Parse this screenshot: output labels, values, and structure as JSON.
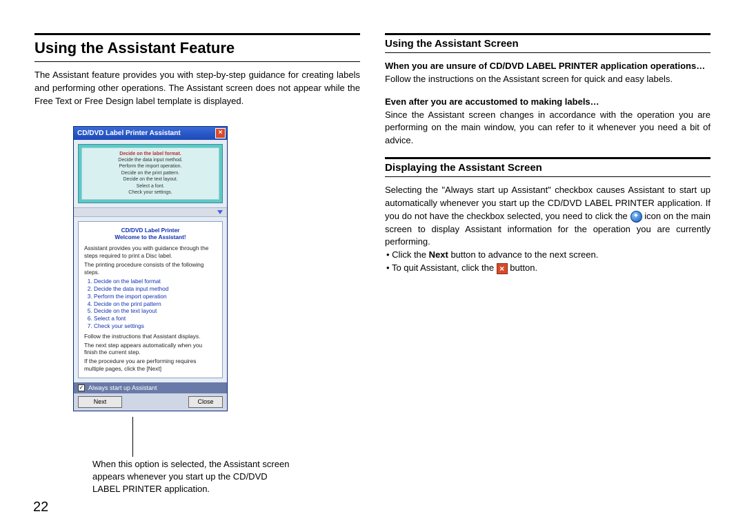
{
  "page_number": "22",
  "left": {
    "heading": "Using the Assistant Feature",
    "intro": "The Assistant feature provides you with step-by-step guidance for creating labels and performing other operations. The Assistant screen does not appear while the Free Text or Free Design label template is displayed.",
    "caption": "When this option is selected, the Assistant screen appears whenever you start up the CD/DVD LABEL PRINTER application."
  },
  "assistant_window": {
    "title": "CD/DVD Label Printer Assistant",
    "steps_current": "Decide on the label format.",
    "steps": [
      "Decide the data input method.",
      "Perform the import operation.",
      "Decide on the print pattern.",
      "Decide on the text layout.",
      "Select a font.",
      "Check your settings."
    ],
    "content_title1": "CD/DVD Label Printer",
    "content_title2": "Welcome to the Assistant!",
    "content_intro": "Assistant provides you with guidance through the steps required to print a Disc label.",
    "content_intro2": "The printing procedure consists of the following steps.",
    "ol": [
      "Decide on the label format",
      "Decide the data input method",
      "Perform the import operation",
      "Decide on the print pattern",
      "Decide on the text layout",
      "Select a font",
      "Check your settings"
    ],
    "content_tail1": "Follow the instructions that Assistant displays.",
    "content_tail2": "The next step appears automatically when you finish the current step.",
    "content_tail3": "If the procedure you are performing requires multiple pages, click the [Next]",
    "checkbox_label": "Always start up Assistant",
    "btn_next": "Next",
    "btn_close": "Close"
  },
  "right": {
    "h2a": "Using the Assistant Screen",
    "sub1": "When you are unsure of CD/DVD LABEL PRINTER application operations…",
    "p1": "Follow the instructions on the Assistant screen for quick and easy labels.",
    "sub2": "Even after you are accustomed to making labels…",
    "p2": "Since the Assistant screen changes in accordance with the operation you are performing on the main window, you can refer to it whenever you need a bit of advice.",
    "h2b": "Displaying the Assistant Screen",
    "p3a": "Selecting the \"Always start up Assistant\" checkbox causes Assistant to start up automatically whenever you start up the CD/DVD LABEL PRINTER application. If you do not have the checkbox selected, you need to click the ",
    "p3b": " icon on the main screen to display Assistant information for the operation you are currently performing.",
    "li1a": "Click the ",
    "li1_bold": "Next",
    "li1b": " button to advance to the next screen.",
    "li2a": "To quit Assistant, click the ",
    "li2b": " button."
  }
}
